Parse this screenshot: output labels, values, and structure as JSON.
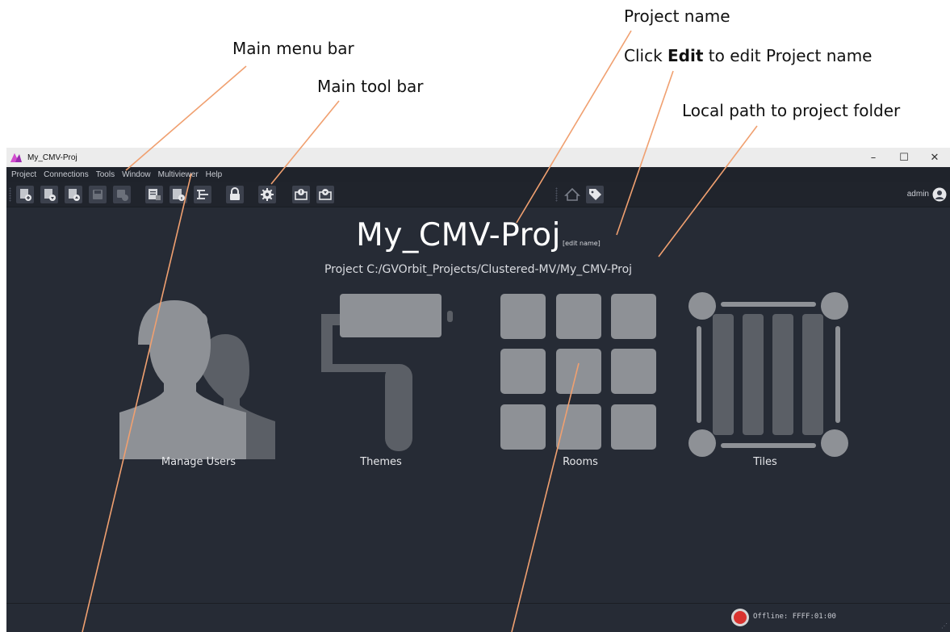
{
  "callouts": {
    "main_menu_bar": "Main menu bar",
    "main_tool_bar": "Main tool bar",
    "project_name": "Project name",
    "click_prefix": "Click",
    "click_bold": "Edit",
    "click_suffix": "to edit Project name",
    "local_path": "Local path to project folder"
  },
  "window": {
    "title": "My_CMV-Proj",
    "minimize": "–",
    "maximize": "☐",
    "close": "✕"
  },
  "menu": [
    "Project",
    "Connections",
    "Tools",
    "Window",
    "Multiviewer",
    "Help"
  ],
  "toolbar_buttons": [
    {
      "name": "new-project-icon"
    },
    {
      "name": "open-project-icon"
    },
    {
      "name": "upload-project-icon"
    },
    {
      "name": "save-icon"
    },
    {
      "name": "save-as-icon"
    },
    {
      "name": "project-report-icon"
    },
    {
      "name": "project-info-icon"
    },
    {
      "name": "hierarchy-icon"
    },
    {
      "name": "lock-icon"
    },
    {
      "name": "settings-gear-icon"
    },
    {
      "name": "deploy-icon"
    },
    {
      "name": "retrieve-icon"
    },
    {
      "name": "home-icon"
    },
    {
      "name": "tag-icon"
    }
  ],
  "user": {
    "name": "admin"
  },
  "project": {
    "name": "My_CMV-Proj",
    "edit_link": "[edit name]",
    "path": "Project C:/GVOrbit_Projects/Clustered-MV/My_CMV-Proj"
  },
  "tiles": {
    "users": "Manage Users",
    "themes": "Themes",
    "rooms": "Rooms",
    "tiles": "Tiles"
  },
  "status": {
    "text": "Offline: FFFF:01:00",
    "indicator_color": "#d9332f"
  },
  "colors": {
    "app_background": "#262b35",
    "icon_light": "#8e9196",
    "icon_dark": "#5b5f66",
    "leader_line": "#f0a070"
  }
}
